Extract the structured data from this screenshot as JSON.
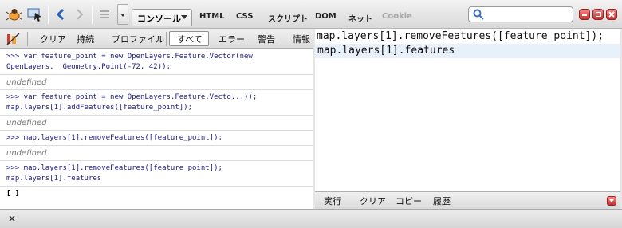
{
  "toolbar": {
    "active_tab": "コンソール",
    "tabs": [
      "HTML",
      "CSS",
      "スクリプト",
      "DOM",
      "ネット",
      "Cookie"
    ],
    "search_placeholder": ""
  },
  "console_toolbar": {
    "items": [
      "クリア",
      "持続",
      "プロファイル",
      "すべて",
      "エラー",
      "警告",
      "情報"
    ]
  },
  "log": [
    {
      "kind": "command",
      "text": ">>> var feature_point = new OpenLayers.Feature.Vector(new\nOpenLayers.  Geometry.Point(-72, 42));"
    },
    {
      "kind": "result",
      "text": "undefined"
    },
    {
      "kind": "command",
      "text": ">>> var feature_point = new OpenLayers.Feature.Vecto...));\nmap.layers[1].addFeatures([feature_point]);"
    },
    {
      "kind": "result",
      "text": "undefined"
    },
    {
      "kind": "command",
      "text": ">>> map.layers[1].removeFeatures([feature_point]);"
    },
    {
      "kind": "result",
      "text": "undefined"
    },
    {
      "kind": "command",
      "text": ">>> map.layers[1].removeFeatures([feature_point]);\nmap.layers[1].features"
    },
    {
      "kind": "array",
      "text": "[ ]"
    }
  ],
  "editor": {
    "lines": [
      "map.layers[1].removeFeatures([feature_point]);",
      "map.layers[1].features"
    ]
  },
  "editor_bar": {
    "run": "実行",
    "clear": "クリア",
    "copy": "コピー",
    "history": "履歴"
  },
  "status": {
    "close": "×"
  }
}
